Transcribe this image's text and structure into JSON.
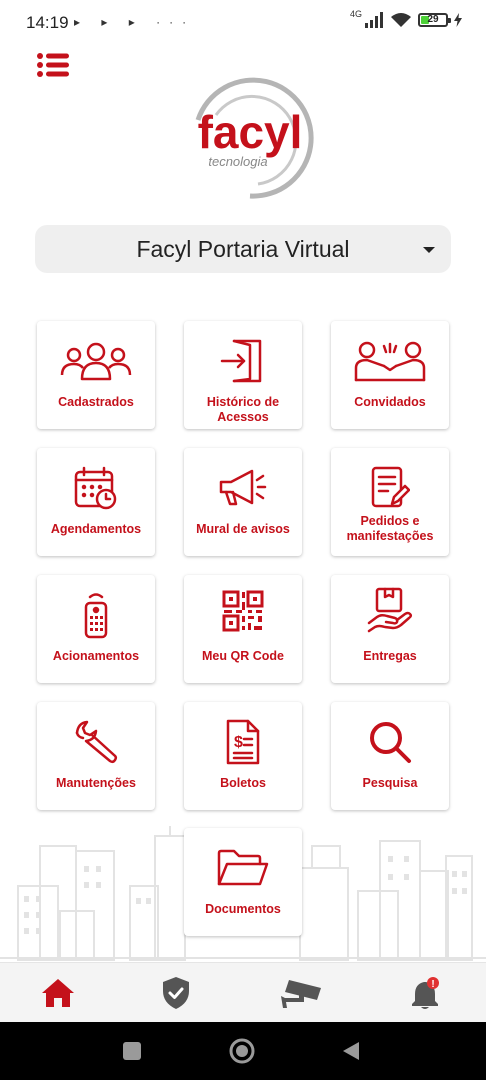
{
  "status_bar": {
    "time": "14:19",
    "left_icons": "▸ ▸ ▸ ···",
    "network_label": "4G",
    "battery_level": "29",
    "battery_percent": 29,
    "icons": [
      "play-notification-icon",
      "play-notification-icon",
      "play-notification-icon",
      "more-dots-icon",
      "signal-icon",
      "wifi-icon",
      "battery-icon",
      "charging-icon"
    ]
  },
  "header": {
    "menu_icon": "menu-list-icon",
    "logo": {
      "brand": "facyl",
      "tagline": "tecnologia"
    }
  },
  "property_selector": {
    "selected": "Facyl Portaria Virtual"
  },
  "tiles": [
    {
      "label": "Cadastrados",
      "icon": "people-group-icon"
    },
    {
      "label": "Histórico de Acessos",
      "icon": "door-enter-icon"
    },
    {
      "label": "Convidados",
      "icon": "guests-icon"
    },
    {
      "label": "Agendamentos",
      "icon": "calendar-clock-icon"
    },
    {
      "label": "Mural de avisos",
      "icon": "megaphone-icon"
    },
    {
      "label": "Pedidos e manifestações",
      "icon": "document-edit-icon"
    },
    {
      "label": "Acionamentos",
      "icon": "remote-control-icon"
    },
    {
      "label": "Meu QR Code",
      "icon": "qr-code-icon"
    },
    {
      "label": "Entregas",
      "icon": "package-hand-icon"
    },
    {
      "label": "Manutenções",
      "icon": "wrench-icon"
    },
    {
      "label": "Boletos",
      "icon": "invoice-icon"
    },
    {
      "label": "Pesquisa",
      "icon": "search-icon"
    },
    {
      "label": "Documentos",
      "icon": "folder-open-icon"
    }
  ],
  "bottom_nav": {
    "items": [
      {
        "icon": "home-icon",
        "active": true
      },
      {
        "icon": "shield-check-icon",
        "active": false
      },
      {
        "icon": "security-camera-icon",
        "active": false
      },
      {
        "icon": "bell-icon",
        "active": false,
        "badge": "!"
      }
    ]
  },
  "system_nav": {
    "icons": [
      "recents-square-icon",
      "home-circle-icon",
      "back-triangle-icon"
    ]
  },
  "colors": {
    "brand_red": "#c4111b",
    "inactive_icon": "#555555",
    "tile_background": "#ffffff",
    "select_background": "#efefef",
    "nav_background": "#f4f4f4"
  }
}
